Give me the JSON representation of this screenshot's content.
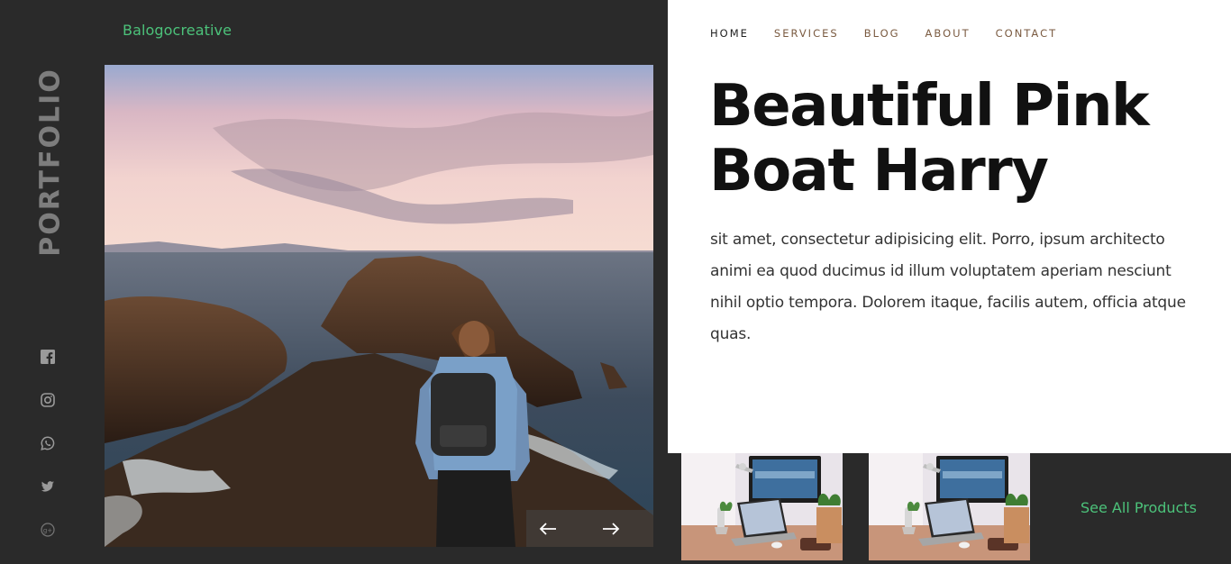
{
  "brand": {
    "name": "Balogocreative"
  },
  "sidebar": {
    "vertical_title": "PORTFOLIO",
    "social_icons": [
      "facebook-icon",
      "instagram-icon",
      "whatsapp-icon",
      "twitter-icon",
      "google-plus-icon"
    ]
  },
  "nav": {
    "items": [
      {
        "label": "HOME",
        "active": true
      },
      {
        "label": "SERVICES",
        "active": false
      },
      {
        "label": "BLOG",
        "active": false
      },
      {
        "label": "ABOUT",
        "active": false
      },
      {
        "label": "CONTACT",
        "active": false
      }
    ]
  },
  "hero": {
    "title_line1": "Beautiful Pink",
    "title_line2": "Boat Harry",
    "body": "sit amet, consectetur adipisicing elit. Porro, ipsum architecto animi ea quod ducimus id illum voluptatem aperiam nesciunt nihil optio tempora. Dolorem itaque, facilis autem, officia atque quas."
  },
  "slider": {
    "prev_icon": "arrow-left-icon",
    "next_icon": "arrow-right-icon"
  },
  "products": {
    "thumbnails": [
      "desk-laptop-thumbnail",
      "desk-laptop-thumbnail"
    ],
    "see_all_label": "See All Products"
  },
  "colors": {
    "accent": "#4cc27a",
    "dark_bg": "#2a2a2a",
    "light_bg": "#ffffff",
    "nav_text": "#7a5a40"
  }
}
